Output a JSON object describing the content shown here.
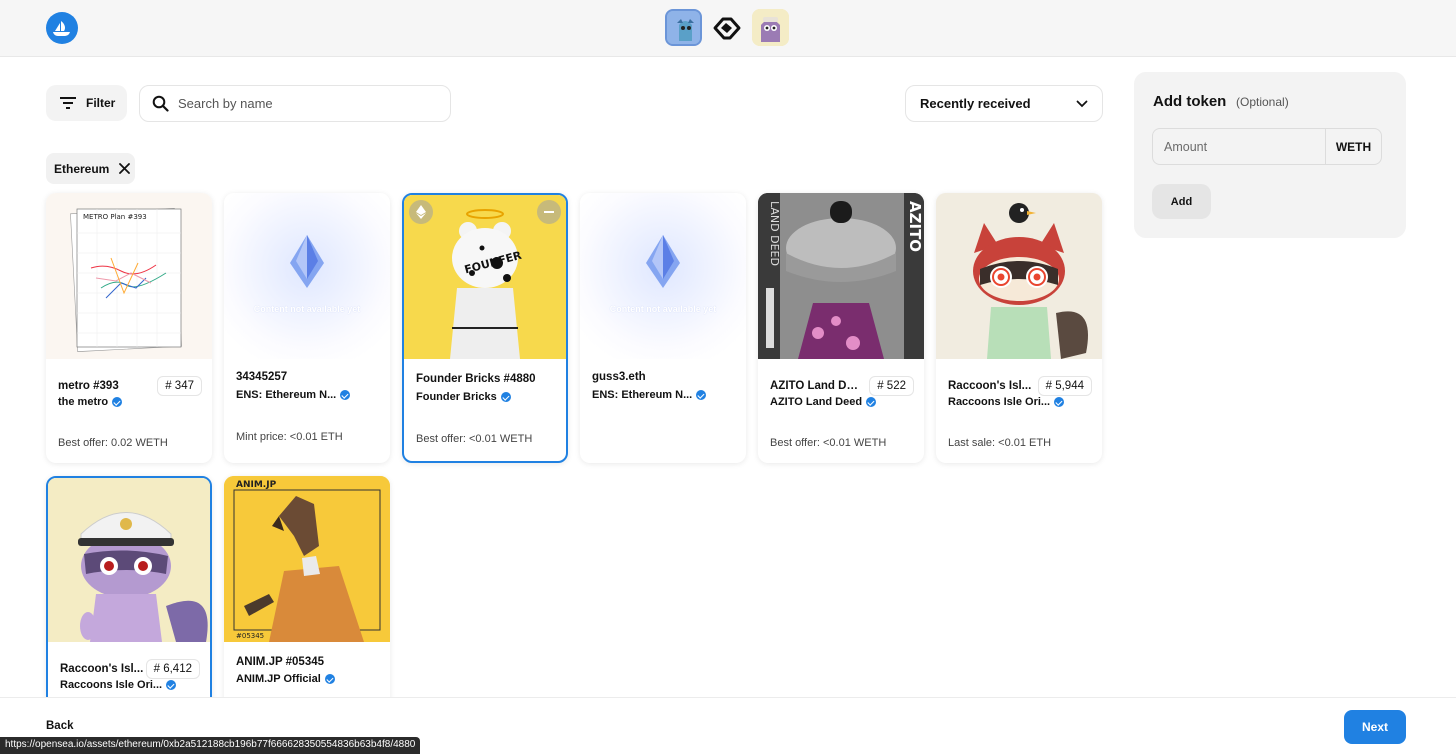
{
  "top": {
    "logo_icon": "opensea-logo-icon",
    "exchange_icon": "handshake-icon",
    "left_avatar_icon": "user-avatar-icon",
    "right_avatar_icon": "counterparty-avatar-icon"
  },
  "toolbar": {
    "filter_label": "Filter",
    "search_placeholder": "Search by name",
    "sort_label": "Recently received"
  },
  "chips": [
    {
      "label": "Ethereum"
    }
  ],
  "cards": [
    {
      "name": "metro #393",
      "tag": "# 347",
      "collection": "the metro",
      "verified": true,
      "meta": "Best offer: 0.02 WETH",
      "selected": false
    },
    {
      "name": "34345257",
      "tag": "",
      "collection": "ENS: Ethereum N...",
      "verified": true,
      "meta": "Mint price: <0.01 ETH",
      "selected": false,
      "img_caption": "Content not available yet"
    },
    {
      "name": "Founder Bricks #4880",
      "tag": "",
      "collection": "Founder Bricks",
      "verified": true,
      "meta": "Best offer: <0.01 WETH",
      "selected": true
    },
    {
      "name": "guss3.eth",
      "tag": "",
      "collection": "ENS: Ethereum N...",
      "verified": true,
      "meta": "",
      "selected": false,
      "img_caption": "Content not available yet"
    },
    {
      "name": "AZITO Land De...",
      "tag": "# 522",
      "collection": "AZITO Land Deed",
      "verified": true,
      "meta": "Best offer: <0.01 WETH",
      "selected": false
    },
    {
      "name": "Raccoon's Isl...",
      "tag": "# 5,944",
      "collection": "Raccoons Isle Ori...",
      "verified": true,
      "meta": "Last sale: <0.01 ETH",
      "selected": false
    },
    {
      "name": "Raccoon's Isl...",
      "tag": "# 6,412",
      "collection": "Raccoons Isle Ori...",
      "verified": true,
      "meta": "",
      "selected": true
    },
    {
      "name": "ANIM.JP #05345",
      "tag": "",
      "collection": "ANIM.JP Official",
      "verified": true,
      "meta": "",
      "selected": false
    }
  ],
  "panel": {
    "title": "Add token",
    "optional": "(Optional)",
    "amount_placeholder": "Amount",
    "currency": "WETH",
    "add_label": "Add"
  },
  "footer": {
    "back_label": "Back",
    "next_label": "Next"
  },
  "status_url": "https://opensea.io/assets/ethereum/0xb2a512188cb196b77f666628350554836b63b4f8/4880",
  "colors": {
    "accent": "#2081e2",
    "selected_border": "#2081e2"
  }
}
